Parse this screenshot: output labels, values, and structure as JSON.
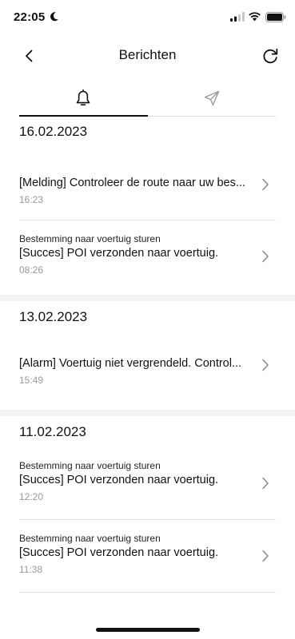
{
  "status_bar": {
    "time": "22:05"
  },
  "header": {
    "title": "Berichten"
  },
  "tabs": [
    {
      "icon": "bell-icon",
      "active": true
    },
    {
      "icon": "send-icon",
      "active": false
    }
  ],
  "sections": [
    {
      "date": "16.02.2023",
      "items": [
        {
          "subtitle": "",
          "title": "[Melding] Controleer de route naar uw bes...",
          "time": "16:23"
        },
        {
          "subtitle": "Bestemming naar voertuig sturen",
          "title": "[Succes] POI verzonden naar voertuig.",
          "time": "08:26"
        }
      ]
    },
    {
      "date": "13.02.2023",
      "items": [
        {
          "subtitle": "",
          "title": "[Alarm] Voertuig niet vergrendeld. Control...",
          "time": "15:49"
        }
      ]
    },
    {
      "date": "11.02.2023",
      "items": [
        {
          "subtitle": "Bestemming naar voertuig sturen",
          "title": "[Succes] POI verzonden naar voertuig.",
          "time": "12:20"
        },
        {
          "subtitle": "Bestemming naar voertuig sturen",
          "title": "[Succes] POI verzonden naar voertuig.",
          "time": "11:38"
        }
      ]
    }
  ]
}
